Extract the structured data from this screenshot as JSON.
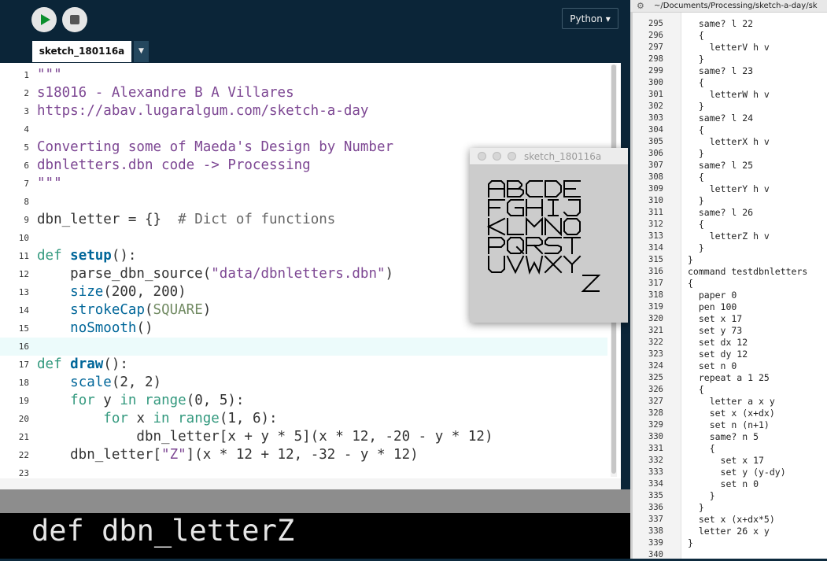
{
  "ide": {
    "mode": "Python ▾",
    "tab": "sketch_180116a",
    "tab_menu": "▼",
    "current_line": 16,
    "lines": [
      {
        "n": "1",
        "segs": [
          {
            "c": "str",
            "t": "\"\"\""
          }
        ]
      },
      {
        "n": "2",
        "segs": [
          {
            "c": "str",
            "t": "s18016 - Alexandre B A Villares"
          }
        ]
      },
      {
        "n": "3",
        "segs": [
          {
            "c": "str",
            "t": "https://abav.lugaralgum.com/sketch-a-day"
          }
        ]
      },
      {
        "n": "4",
        "segs": []
      },
      {
        "n": "5",
        "segs": [
          {
            "c": "str",
            "t": "Converting some of Maeda's Design by Number"
          }
        ]
      },
      {
        "n": "6",
        "segs": [
          {
            "c": "str",
            "t": "dbnletters.dbn code -> Processing"
          }
        ]
      },
      {
        "n": "7",
        "segs": [
          {
            "c": "str",
            "t": "\"\"\""
          }
        ]
      },
      {
        "n": "8",
        "segs": []
      },
      {
        "n": "9",
        "segs": [
          {
            "c": "",
            "t": "dbn_letter = {}  "
          },
          {
            "c": "com",
            "t": "# Dict of functions"
          }
        ]
      },
      {
        "n": "10",
        "segs": []
      },
      {
        "n": "11",
        "segs": [
          {
            "c": "kw",
            "t": "def"
          },
          {
            "c": "",
            "t": " "
          },
          {
            "c": "fnb",
            "t": "setup"
          },
          {
            "c": "",
            "t": "():"
          }
        ]
      },
      {
        "n": "12",
        "segs": [
          {
            "c": "",
            "t": "    parse_dbn_source("
          },
          {
            "c": "lit",
            "t": "\"data/dbnletters.dbn\""
          },
          {
            "c": "",
            "t": ")"
          }
        ]
      },
      {
        "n": "13",
        "segs": [
          {
            "c": "",
            "t": "    "
          },
          {
            "c": "fn",
            "t": "size"
          },
          {
            "c": "",
            "t": "(200, 200)"
          }
        ]
      },
      {
        "n": "14",
        "segs": [
          {
            "c": "",
            "t": "    "
          },
          {
            "c": "fn",
            "t": "strokeCap"
          },
          {
            "c": "",
            "t": "("
          },
          {
            "c": "const",
            "t": "SQUARE"
          },
          {
            "c": "",
            "t": ")"
          }
        ]
      },
      {
        "n": "15",
        "segs": [
          {
            "c": "",
            "t": "    "
          },
          {
            "c": "fn",
            "t": "noSmooth"
          },
          {
            "c": "",
            "t": "()"
          }
        ]
      },
      {
        "n": "16",
        "segs": []
      },
      {
        "n": "17",
        "segs": [
          {
            "c": "kw",
            "t": "def"
          },
          {
            "c": "",
            "t": " "
          },
          {
            "c": "fnb",
            "t": "draw"
          },
          {
            "c": "",
            "t": "():"
          }
        ]
      },
      {
        "n": "18",
        "segs": [
          {
            "c": "",
            "t": "    "
          },
          {
            "c": "fn",
            "t": "scale"
          },
          {
            "c": "",
            "t": "(2, 2)"
          }
        ]
      },
      {
        "n": "19",
        "segs": [
          {
            "c": "",
            "t": "    "
          },
          {
            "c": "kw",
            "t": "for"
          },
          {
            "c": "",
            "t": " y "
          },
          {
            "c": "kw",
            "t": "in"
          },
          {
            "c": "",
            "t": " "
          },
          {
            "c": "kw",
            "t": "range"
          },
          {
            "c": "",
            "t": "(0, 5):"
          }
        ]
      },
      {
        "n": "20",
        "segs": [
          {
            "c": "",
            "t": "        "
          },
          {
            "c": "kw",
            "t": "for"
          },
          {
            "c": "",
            "t": " x "
          },
          {
            "c": "kw",
            "t": "in"
          },
          {
            "c": "",
            "t": " "
          },
          {
            "c": "kw",
            "t": "range"
          },
          {
            "c": "",
            "t": "(1, 6):"
          }
        ]
      },
      {
        "n": "21",
        "segs": [
          {
            "c": "",
            "t": "            dbn_letter[x + y * 5](x * 12, -20 - y * 12)"
          }
        ]
      },
      {
        "n": "22",
        "segs": [
          {
            "c": "",
            "t": "    dbn_letter["
          },
          {
            "c": "lit",
            "t": "\"Z\""
          },
          {
            "c": "",
            "t": "](x * 12 + 12, -32 - y * 12)"
          }
        ]
      },
      {
        "n": "23",
        "segs": []
      }
    ],
    "console_text": "def dbn_letterZ"
  },
  "sketch_window": {
    "title": "sketch_180116a",
    "letter_rows": [
      "ABCDE",
      "FGHIJ",
      "KLMNO",
      "PQRST",
      "UVWXY"
    ],
    "extra_letter": "Z"
  },
  "text_editor": {
    "path": "~/Documents/Processing/sketch-a-day/sk",
    "gear": "⚙",
    "lines": [
      {
        "n": "295",
        "t": "  same? l 22"
      },
      {
        "n": "296",
        "t": "  {"
      },
      {
        "n": "297",
        "t": "    letterV h v"
      },
      {
        "n": "298",
        "t": "  }"
      },
      {
        "n": "299",
        "t": "  same? l 23"
      },
      {
        "n": "300",
        "t": "  {"
      },
      {
        "n": "301",
        "t": "    letterW h v"
      },
      {
        "n": "302",
        "t": "  }"
      },
      {
        "n": "303",
        "t": "  same? l 24"
      },
      {
        "n": "304",
        "t": "  {"
      },
      {
        "n": "305",
        "t": "    letterX h v"
      },
      {
        "n": "306",
        "t": "  }"
      },
      {
        "n": "307",
        "t": "  same? l 25"
      },
      {
        "n": "308",
        "t": "  {"
      },
      {
        "n": "309",
        "t": "    letterY h v"
      },
      {
        "n": "310",
        "t": "  }"
      },
      {
        "n": "311",
        "t": "  same? l 26"
      },
      {
        "n": "312",
        "t": "  {"
      },
      {
        "n": "313",
        "t": "    letterZ h v"
      },
      {
        "n": "314",
        "t": "  }"
      },
      {
        "n": "315",
        "t": "}"
      },
      {
        "n": "316",
        "t": "command testdbnletters"
      },
      {
        "n": "317",
        "t": "{"
      },
      {
        "n": "318",
        "t": "  paper 0"
      },
      {
        "n": "319",
        "t": "  pen 100"
      },
      {
        "n": "320",
        "t": "  set x 17"
      },
      {
        "n": "321",
        "t": "  set y 73"
      },
      {
        "n": "322",
        "t": "  set dx 12"
      },
      {
        "n": "323",
        "t": "  set dy 12"
      },
      {
        "n": "324",
        "t": "  set n 0"
      },
      {
        "n": "325",
        "t": "  repeat a 1 25"
      },
      {
        "n": "326",
        "t": "  {"
      },
      {
        "n": "327",
        "t": "    letter a x y"
      },
      {
        "n": "328",
        "t": "    set x (x+dx)"
      },
      {
        "n": "329",
        "t": "    set n (n+1)"
      },
      {
        "n": "330",
        "t": "    same? n 5"
      },
      {
        "n": "331",
        "t": "    {"
      },
      {
        "n": "332",
        "t": "      set x 17"
      },
      {
        "n": "333",
        "t": "      set y (y-dy)"
      },
      {
        "n": "334",
        "t": "      set n 0"
      },
      {
        "n": "335",
        "t": "    }"
      },
      {
        "n": "336",
        "t": "  }"
      },
      {
        "n": "337",
        "t": "  set x (x+dx*5)"
      },
      {
        "n": "338",
        "t": "  letter 26 x y"
      },
      {
        "n": "339",
        "t": "}"
      },
      {
        "n": "340",
        "t": ""
      }
    ]
  },
  "colors": {
    "ide_background": "#0b2538",
    "run_icon": "#0a8f2c",
    "string": "#7d4793",
    "keyword": "#33997e",
    "function": "#006699"
  }
}
